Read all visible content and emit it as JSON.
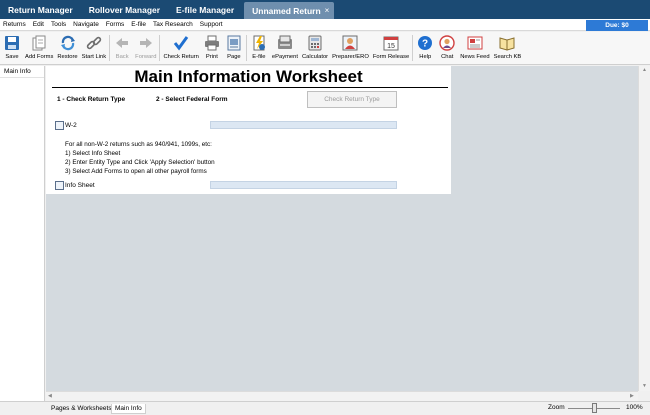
{
  "topbar": {
    "tabs": [
      "Return Manager",
      "Rollover Manager",
      "E-file Manager"
    ],
    "active_tab": "Unnamed Return",
    "close_glyph": "×"
  },
  "menubar": {
    "items": [
      "Returns",
      "Edit",
      "Tools",
      "Navigate",
      "Forms",
      "E-file",
      "Tax Research",
      "Support"
    ],
    "due": "Due: $0"
  },
  "toolbar": {
    "buttons": [
      {
        "label": "Save",
        "icon": "save-icon"
      },
      {
        "label": "Add Forms",
        "icon": "add-forms-icon"
      },
      {
        "label": "Restore",
        "icon": "restore-icon"
      },
      {
        "label": "Start Link",
        "icon": "link-icon"
      },
      {
        "label": "Back",
        "icon": "back-arrow-icon"
      },
      {
        "label": "Forward",
        "icon": "forward-arrow-icon"
      },
      {
        "label": "Check Return",
        "icon": "checkmark-icon"
      },
      {
        "label": "Print",
        "icon": "printer-icon"
      },
      {
        "label": "Page",
        "icon": "page-icon"
      },
      {
        "label": "E-file",
        "icon": "efile-icon"
      },
      {
        "label": "ePayment",
        "icon": "epayment-icon"
      },
      {
        "label": "Calculator",
        "icon": "calculator-icon"
      },
      {
        "label": "Preparer/ERO",
        "icon": "preparer-icon"
      },
      {
        "label": "Form Release",
        "icon": "calendar-icon",
        "icon_text": "15"
      },
      {
        "label": "Help",
        "icon": "help-icon",
        "icon_text": "?"
      },
      {
        "label": "Chat",
        "icon": "chat-icon"
      },
      {
        "label": "News Feed",
        "icon": "news-icon"
      },
      {
        "label": "Search KB",
        "icon": "book-icon"
      }
    ]
  },
  "leftpanel": {
    "item": "Main Info"
  },
  "worksheet": {
    "title": "Main Information Worksheet",
    "step1": "1 - Check Return Type",
    "step2": "2 - Select Federal Form",
    "check_button": "Check Return Type",
    "w2_label": "W-2",
    "instructions": [
      "For all non-W-2 returns such as 940/941, 1099s, etc:",
      "1) Select Info Sheet",
      "2) Enter Entity Type and Click 'Apply Selection' button",
      "3) Select Add Forms to open all other payroll forms"
    ],
    "info_label": "Info Sheet"
  },
  "statusbar": {
    "tabs": [
      "Pages & Worksheets",
      "Main Info"
    ],
    "zoom_label": "Zoom",
    "zoom_value": "100%"
  },
  "colors": {
    "topbar": "#1b4a73",
    "due_badge": "#2d7ad6",
    "field": "#dce7f3",
    "workspace": "#d4dadf"
  }
}
